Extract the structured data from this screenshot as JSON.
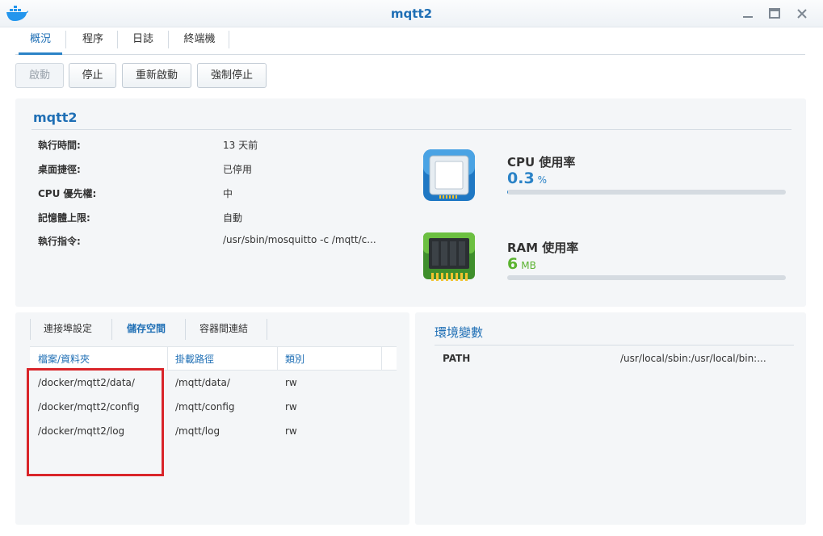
{
  "window": {
    "title": "mqtt2"
  },
  "tabs": [
    {
      "label": "概況"
    },
    {
      "label": "程序"
    },
    {
      "label": "日誌"
    },
    {
      "label": "終端機"
    }
  ],
  "toolbar": {
    "start_label": "啟動",
    "stop_label": "停止",
    "restart_label": "重新啟動",
    "force_stop_label": "強制停止"
  },
  "info": {
    "title": "mqtt2",
    "rows": [
      {
        "label": "執行時間:",
        "value": "13 天前"
      },
      {
        "label": "桌面捷徑:",
        "value": "已停用"
      },
      {
        "label": "CPU 優先權:",
        "value": "中"
      },
      {
        "label": "記憶體上限:",
        "value": "自動"
      },
      {
        "label": "執行指令:",
        "value": "/usr/sbin/mosquitto -c /mqtt/c..."
      }
    ]
  },
  "cpu": {
    "title": "CPU 使用率",
    "value": "0.3",
    "unit": "%",
    "fraction": 0.003,
    "color": "#2b83c7"
  },
  "ram": {
    "title": "RAM 使用率",
    "value": "6",
    "unit": "MB",
    "fraction": 0.0,
    "color": "#5bb330"
  },
  "subtabs": [
    {
      "label": "連接埠設定"
    },
    {
      "label": "儲存空間"
    },
    {
      "label": "容器間連結"
    }
  ],
  "storage": {
    "columns": [
      "檔案/資料夾",
      "掛載路徑",
      "類別"
    ],
    "rows": [
      {
        "path": "/docker/mqtt2/data/",
        "mount": "/mqtt/data/",
        "type": "rw"
      },
      {
        "path": "/docker/mqtt2/config",
        "mount": "/mqtt/config",
        "type": "rw"
      },
      {
        "path": "/docker/mqtt2/log",
        "mount": "/mqtt/log",
        "type": "rw"
      }
    ]
  },
  "env": {
    "title": "環境變數",
    "rows": [
      {
        "key": "PATH",
        "value": "/usr/local/sbin:/usr/local/bin:..."
      }
    ]
  },
  "icons": {
    "app": "docker-whale-icon",
    "minimize": "minimize-icon",
    "maximize": "maximize-icon",
    "close": "close-icon",
    "cpu": "cpu-chip-icon",
    "ram": "ram-module-icon"
  },
  "colors": {
    "accent": "#1f6fb5",
    "highlight": "#d9252a"
  }
}
